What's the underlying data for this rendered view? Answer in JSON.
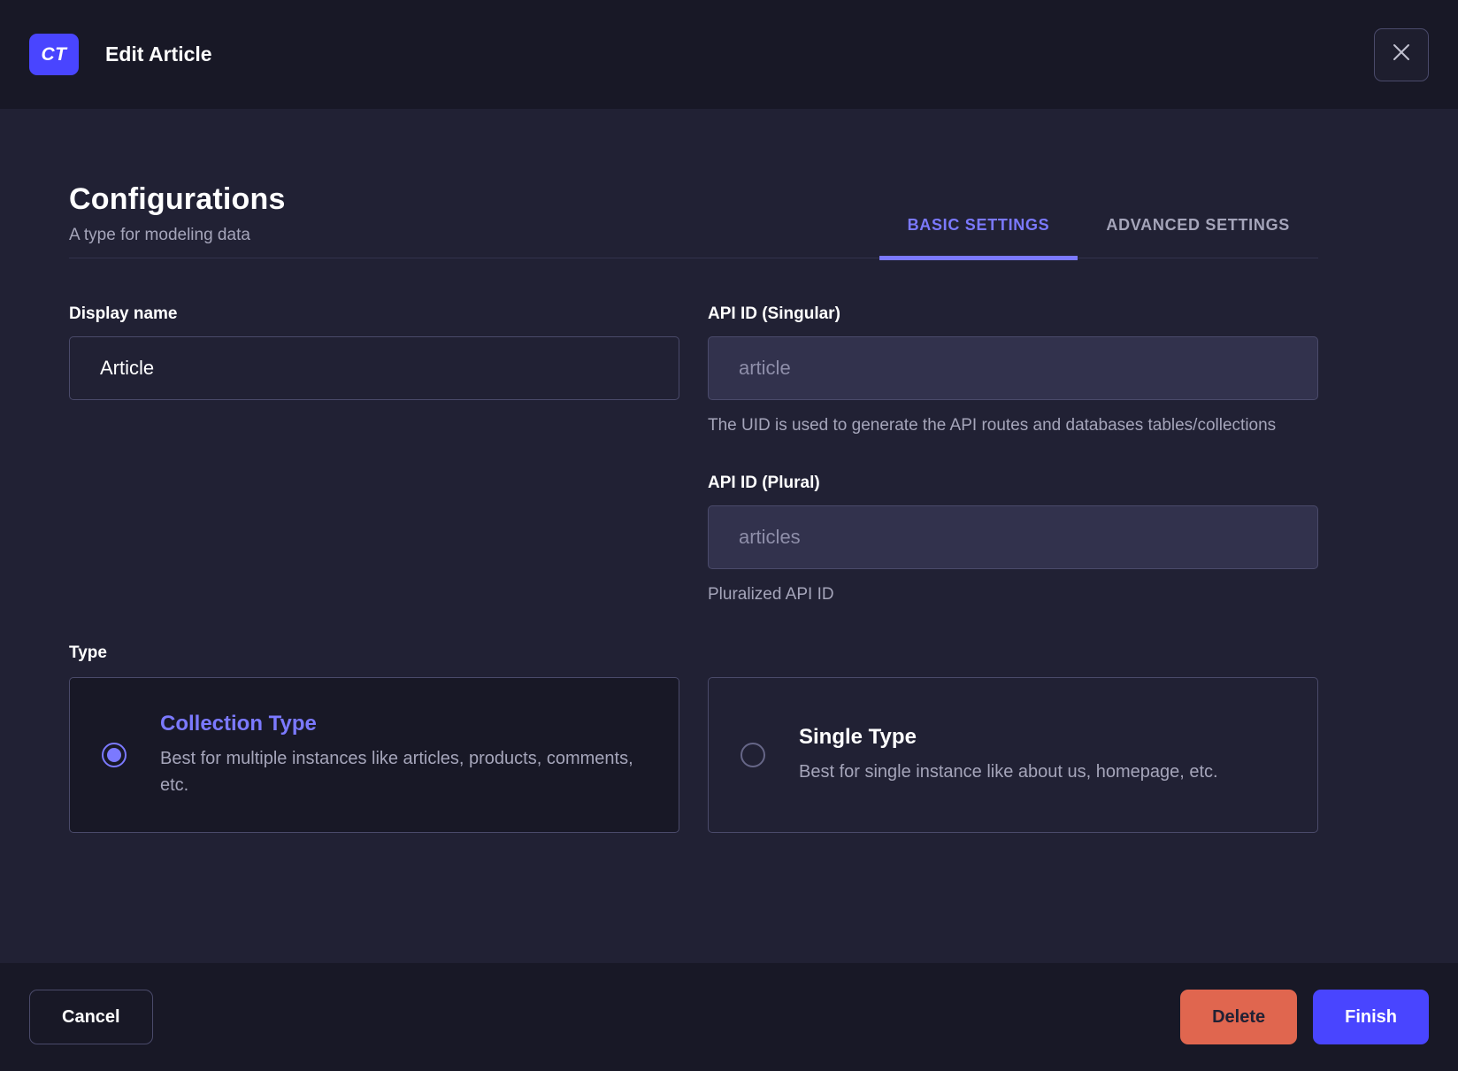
{
  "header": {
    "badge": "CT",
    "title": "Edit Article"
  },
  "section": {
    "title": "Configurations",
    "subtitle": "A type for modeling data"
  },
  "tabs": {
    "basic": "BASIC SETTINGS",
    "advanced": "ADVANCED SETTINGS"
  },
  "fields": {
    "display_name": {
      "label": "Display name",
      "value": "Article"
    },
    "api_id_singular": {
      "label": "API ID (Singular)",
      "placeholder": "article",
      "hint": "The UID is used to generate the API routes and databases tables/collections"
    },
    "api_id_plural": {
      "label": "API ID (Plural)",
      "placeholder": "articles",
      "hint": "Pluralized API ID"
    }
  },
  "type": {
    "label": "Type",
    "options": [
      {
        "title": "Collection Type",
        "description": "Best for multiple instances like articles, products, comments, etc.",
        "selected": true
      },
      {
        "title": "Single Type",
        "description": "Best for single instance like about us, homepage, etc.",
        "selected": false
      }
    ]
  },
  "footer": {
    "cancel": "Cancel",
    "delete": "Delete",
    "finish": "Finish"
  },
  "colors": {
    "accent": "#4945ff",
    "accent_light": "#7b79ff",
    "danger": "#e0664f",
    "background": "#212134",
    "surface_dark": "#181826",
    "input_filled": "#32324d",
    "border": "#4a4a6a",
    "text_muted": "#a5a5ba"
  }
}
